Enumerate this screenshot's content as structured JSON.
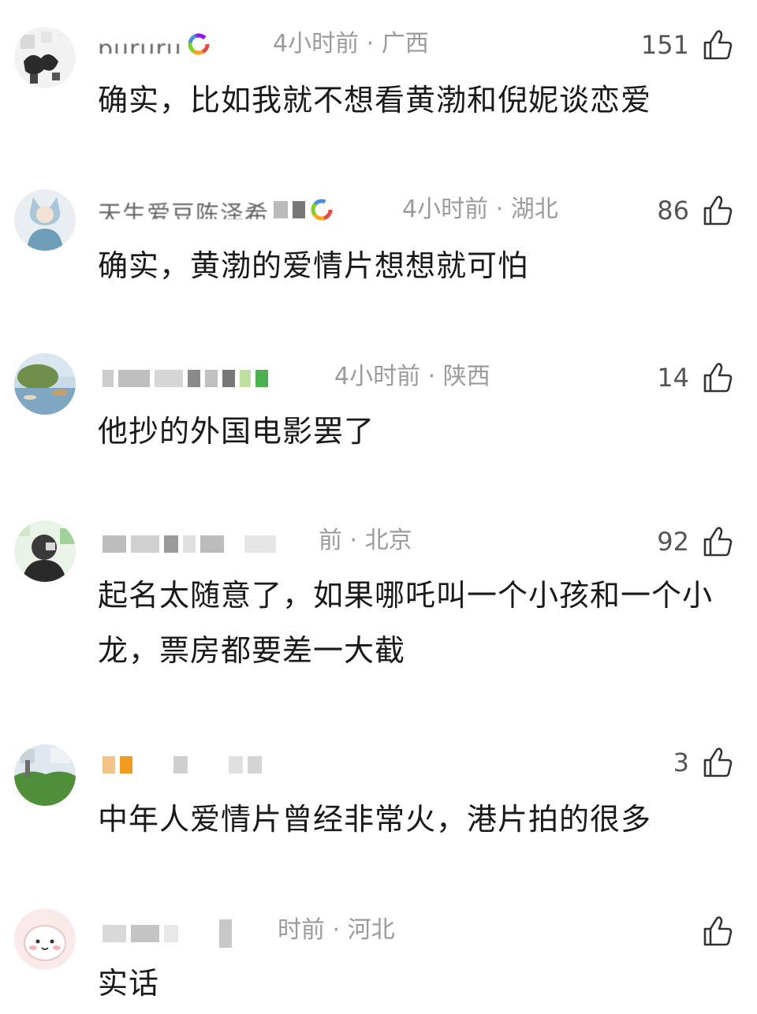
{
  "comments": [
    {
      "username": "pururu",
      "time_location": "4小时前 · 广西",
      "likes": "151",
      "text": "确实，比如我就不想看黄渤和倪妮谈恋爱"
    },
    {
      "username": "天生爱豆陈泽希",
      "time_location": "4小时前 · 湖北",
      "likes": "86",
      "text": "确实，黄渤的爱情片想想就可怕"
    },
    {
      "username": "",
      "time_location": "4小时前 · 陕西",
      "likes": "14",
      "text": "他抄的外国电影罢了"
    },
    {
      "username": "",
      "time_location": "前 · 北京",
      "likes": "92",
      "text": "起名太随意了，如果哪吒叫一个小孩和一个小龙，票房都要差一大截"
    },
    {
      "username": "",
      "time_location": "",
      "likes": "3",
      "text": "中年人爱情片曾经非常火，港片拍的很多"
    },
    {
      "username": "",
      "time_location": "时前 · 河北",
      "likes": "",
      "text": "实话"
    }
  ],
  "icons": {
    "like": "thumbs-up-icon"
  },
  "colors": {
    "meta": "#9b9b9b",
    "text": "#1a1a1a"
  }
}
